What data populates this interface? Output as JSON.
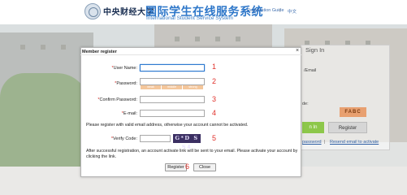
{
  "header": {
    "logo_text": "中央财经大学",
    "title": "国际学生在线服务系统",
    "subtitle": "International Student Service System",
    "link_guide": "Registration Guide",
    "separator": "|",
    "link_lang": "中文"
  },
  "signin_panel": {
    "title": "Sign In",
    "label_user": "/Email",
    "label_code": "de:",
    "captcha": "FABC",
    "login_button": "n In",
    "register_button": "Register",
    "link_password": "password",
    "link_separator": "|",
    "link_resend": "Resend email to activate"
  },
  "dialog": {
    "title": "Member register",
    "close": "×",
    "fields": {
      "username": {
        "label": "User Name:",
        "value": "",
        "marker": "1"
      },
      "password": {
        "label": "Password:",
        "value": "",
        "marker": "2",
        "strength": [
          "weak",
          "middle",
          "strong"
        ]
      },
      "confirm": {
        "label": "Confirm Password:",
        "value": "",
        "marker": "3"
      },
      "email": {
        "label": "E-mail:",
        "value": "",
        "marker": "4"
      },
      "verify": {
        "label": "Verify Code:",
        "value": "",
        "marker": "5",
        "captcha": "G*D S S4"
      }
    },
    "email_note": "Please register with valid email address, otherwise your account cannot be activated.",
    "after_note": "After successful registration, an account activate link will be sent to your email. Please activate your account by clicking the link.",
    "register_button": "Register",
    "register_marker": "6",
    "close_button": "Close",
    "required_mark": "*"
  }
}
